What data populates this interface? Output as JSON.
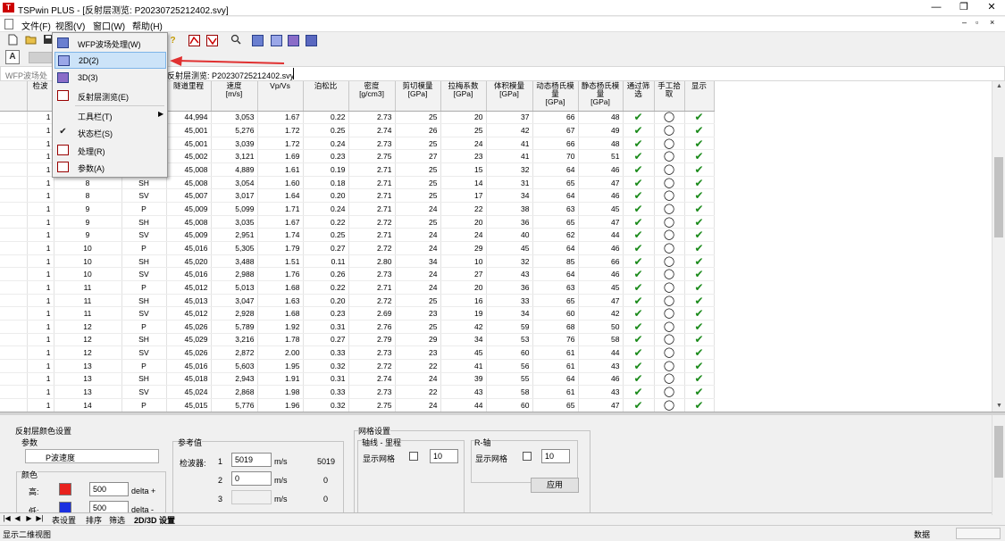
{
  "window": {
    "title": "TSPwin PLUS - [反射层测览: P20230725212402.svy]",
    "logo": "T",
    "minimize": "—",
    "restore": "❐",
    "close": "✕",
    "inner_minimize": "–",
    "inner_restore": "▫",
    "inner_close": "×"
  },
  "menubar": {
    "items": [
      "文件(F)",
      "视图(V)",
      "窗口(W)",
      "帮助(H)"
    ]
  },
  "toolbar": {
    "icons": [
      "new-file-icon",
      "open-folder-icon",
      "save-icon",
      "help-icon",
      "reflect-red-icon",
      "reflect-red-icon",
      "zoom-icon",
      "wfp-icon",
      "2d-icon",
      "3d-icon",
      "params-icon"
    ],
    "help_glyph": "?",
    "zoom_glyph": "🔍"
  },
  "tabstrip": {
    "view_glyph": "A"
  },
  "docbar": {
    "path_left": "WFP波场处",
    "path_right": "反射层测览: P20230725212402.svy"
  },
  "context_menu": {
    "items": [
      {
        "label": "WFP波场处理(W)",
        "icon": "wfp-icon"
      },
      {
        "label": "2D(2)",
        "icon": "2d-icon",
        "highlighted": true
      },
      {
        "label": "3D(3)",
        "icon": "3d-icon"
      },
      {
        "label": "反射层测览(E)",
        "icon": "reflect-icon"
      },
      {
        "label": "工具栏(T)",
        "icon": "",
        "submenu": true
      },
      {
        "label": "状态栏(S)",
        "icon": "check-icon",
        "checked": true
      },
      {
        "label": "处理(R)",
        "icon": "process-icon"
      },
      {
        "label": "参数(A)",
        "icon": "params-icon"
      }
    ],
    "check_glyph": "✔",
    "submenu_glyph": "▶"
  },
  "grid": {
    "headers": [
      "",
      "检波",
      "",
      "",
      "隧道里程",
      "速度\n[m/s]",
      "Vp/Vs",
      "泊松比",
      "密度\n[g/cm3]",
      "剪切模量\n[GPa]",
      "拉梅系数\n[GPa]",
      "体积模量\n[GPa]",
      "动态杨氏模\n量\n[GPa]",
      "静态杨氏模\n量\n[GPa]",
      "通过筛\n选",
      "手工拾\n取",
      "显示"
    ],
    "rows": [
      [
        "1",
        "",
        "",
        "44,994",
        "3,053",
        "1.67",
        "0.22",
        "2.73",
        "25",
        "20",
        "37",
        "66",
        "48"
      ],
      [
        "1",
        "",
        "",
        "45,001",
        "5,276",
        "1.72",
        "0.25",
        "2.74",
        "26",
        "25",
        "42",
        "67",
        "49"
      ],
      [
        "1",
        "",
        "",
        "45,001",
        "3,039",
        "1.72",
        "0.24",
        "2.73",
        "25",
        "24",
        "41",
        "66",
        "48"
      ],
      [
        "1",
        "",
        "",
        "45,002",
        "3,121",
        "1.69",
        "0.23",
        "2.75",
        "27",
        "23",
        "41",
        "70",
        "51"
      ],
      [
        "1",
        "",
        "",
        "45,008",
        "4,889",
        "1.61",
        "0.19",
        "2.71",
        "25",
        "15",
        "32",
        "64",
        "46"
      ],
      [
        "1",
        "8",
        "SH",
        "45,008",
        "3,054",
        "1.60",
        "0.18",
        "2.71",
        "25",
        "14",
        "31",
        "65",
        "47"
      ],
      [
        "1",
        "8",
        "SV",
        "45,007",
        "3,017",
        "1.64",
        "0.20",
        "2.71",
        "25",
        "17",
        "34",
        "64",
        "46"
      ],
      [
        "1",
        "9",
        "P",
        "45,009",
        "5,099",
        "1.71",
        "0.24",
        "2.71",
        "24",
        "22",
        "38",
        "63",
        "45"
      ],
      [
        "1",
        "9",
        "SH",
        "45,008",
        "3,035",
        "1.67",
        "0.22",
        "2.72",
        "25",
        "20",
        "36",
        "65",
        "47"
      ],
      [
        "1",
        "9",
        "SV",
        "45,009",
        "2,951",
        "1.74",
        "0.25",
        "2.71",
        "24",
        "24",
        "40",
        "62",
        "44"
      ],
      [
        "1",
        "10",
        "P",
        "45,016",
        "5,305",
        "1.79",
        "0.27",
        "2.72",
        "24",
        "29",
        "45",
        "64",
        "46"
      ],
      [
        "1",
        "10",
        "SH",
        "45,020",
        "3,488",
        "1.51",
        "0.11",
        "2.80",
        "34",
        "10",
        "32",
        "85",
        "66"
      ],
      [
        "1",
        "10",
        "SV",
        "45,016",
        "2,988",
        "1.76",
        "0.26",
        "2.73",
        "24",
        "27",
        "43",
        "64",
        "46"
      ],
      [
        "1",
        "11",
        "P",
        "45,012",
        "5,013",
        "1.68",
        "0.22",
        "2.71",
        "24",
        "20",
        "36",
        "63",
        "45"
      ],
      [
        "1",
        "11",
        "SH",
        "45,013",
        "3,047",
        "1.63",
        "0.20",
        "2.72",
        "25",
        "16",
        "33",
        "65",
        "47"
      ],
      [
        "1",
        "11",
        "SV",
        "45,012",
        "2,928",
        "1.68",
        "0.23",
        "2.69",
        "23",
        "19",
        "34",
        "60",
        "42"
      ],
      [
        "1",
        "12",
        "P",
        "45,026",
        "5,789",
        "1.92",
        "0.31",
        "2.76",
        "25",
        "42",
        "59",
        "68",
        "50"
      ],
      [
        "1",
        "12",
        "SH",
        "45,029",
        "3,216",
        "1.78",
        "0.27",
        "2.79",
        "29",
        "34",
        "53",
        "76",
        "58"
      ],
      [
        "1",
        "12",
        "SV",
        "45,026",
        "2,872",
        "2.00",
        "0.33",
        "2.73",
        "23",
        "45",
        "60",
        "61",
        "44"
      ],
      [
        "1",
        "13",
        "P",
        "45,016",
        "5,603",
        "1.95",
        "0.32",
        "2.72",
        "22",
        "41",
        "56",
        "61",
        "43"
      ],
      [
        "1",
        "13",
        "SH",
        "45,018",
        "2,943",
        "1.91",
        "0.31",
        "2.74",
        "24",
        "39",
        "55",
        "64",
        "46"
      ],
      [
        "1",
        "13",
        "SV",
        "45,024",
        "2,868",
        "1.98",
        "0.33",
        "2.73",
        "22",
        "43",
        "58",
        "61",
        "43"
      ],
      [
        "1",
        "14",
        "P",
        "45,015",
        "5,776",
        "1.96",
        "0.32",
        "2.75",
        "24",
        "44",
        "60",
        "65",
        "47"
      ]
    ],
    "check_glyph": "✔",
    "radio_glyph": "◯"
  },
  "panel": {
    "title": "反射层颜色设置",
    "param_group": "参数",
    "param_select": "P波速度",
    "color_group": "颜色",
    "high_label": "高:",
    "high_value": "500",
    "high_suffix": "delta +",
    "high_color": "#e8221e",
    "low_label": "低:",
    "low_value": "500",
    "low_suffix": "delta -",
    "low_color": "#1b2fe0",
    "ref_group": "参考值",
    "detector_label": "检波器:",
    "ref_rows": [
      {
        "idx": "1",
        "value": "5019",
        "unit": "m/s",
        "result": "5019"
      },
      {
        "idx": "2",
        "value": "0",
        "unit": "m/s",
        "result": "0"
      },
      {
        "idx": "3",
        "value": "",
        "unit": "m/s",
        "result": "0"
      }
    ],
    "grid_title": "网格设置",
    "axis_group": "轴线 - 里程",
    "axis_show": "显示网格",
    "axis_value": "10",
    "r_group": "R-轴",
    "r_show": "显示网格",
    "r_value": "10",
    "apply": "应用"
  },
  "sheets": {
    "nav": [
      "|◀",
      "◀",
      "▶",
      "▶|"
    ],
    "tabs": [
      "表设置",
      "排序",
      "筛选",
      "2D/3D 设置"
    ]
  },
  "status": {
    "text": "显示二维视图",
    "right": "数据"
  }
}
